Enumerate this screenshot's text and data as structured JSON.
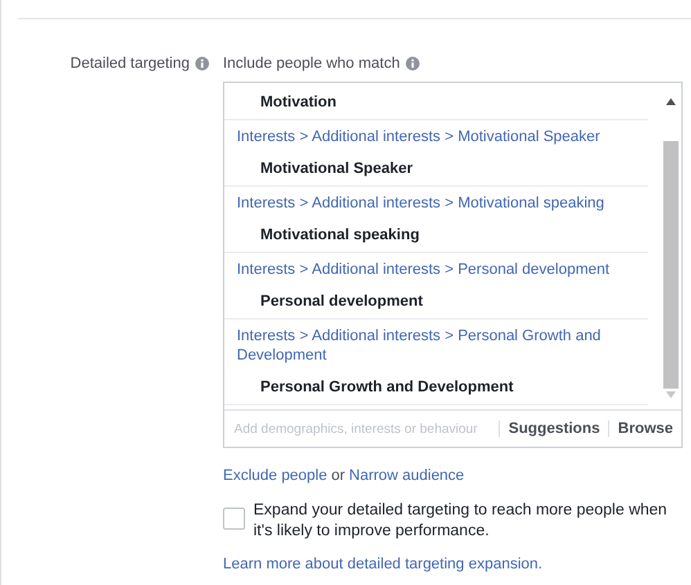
{
  "field_label": "Detailed targeting",
  "include_label": "Include people who match",
  "items": [
    {
      "kind": "name",
      "text": "Motivation"
    },
    {
      "kind": "path",
      "text": "Interests > Additional interests > Motivational Speaker"
    },
    {
      "kind": "name",
      "text": "Motivational Speaker"
    },
    {
      "kind": "path",
      "text": "Interests > Additional interests > Motivational speaking"
    },
    {
      "kind": "name",
      "text": "Motivational speaking"
    },
    {
      "kind": "path",
      "text": "Interests > Additional interests > Personal development"
    },
    {
      "kind": "name",
      "text": "Personal development"
    },
    {
      "kind": "path",
      "text": "Interests > Additional interests > Personal Growth and Development"
    },
    {
      "kind": "name",
      "text": "Personal Growth and Development"
    }
  ],
  "search": {
    "placeholder": "Add demographics, interests or behaviour"
  },
  "suggestions": "Suggestions",
  "browse": "Browse",
  "exclude_link": "Exclude people",
  "or_text": "or",
  "narrow_link": "Narrow audience",
  "expand": {
    "checked": false,
    "text": "Expand your detailed targeting to reach more people when it's likely to improve performance."
  },
  "learn_more": "Learn more about detailed targeting expansion."
}
